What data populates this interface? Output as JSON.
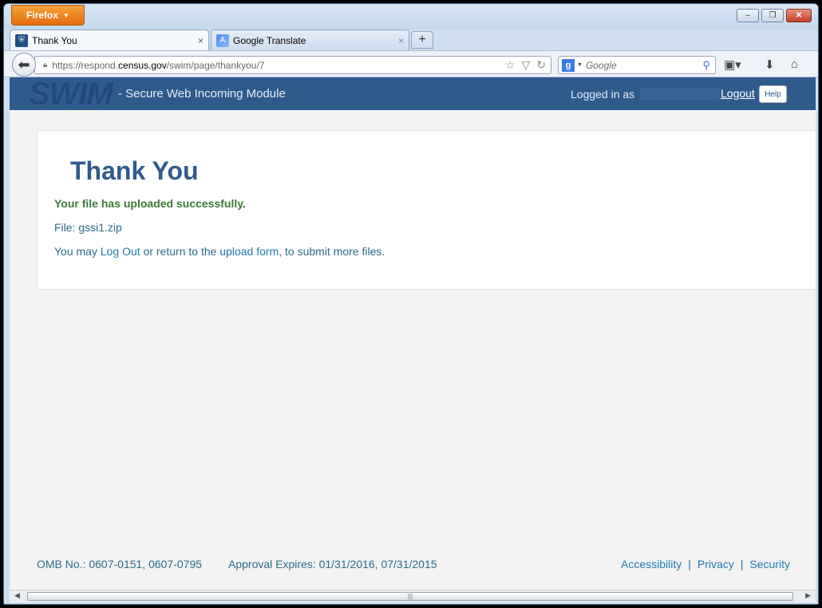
{
  "browser": {
    "app_button_label": "Firefox",
    "tabs": [
      {
        "label": "Thank You",
        "close": "×"
      },
      {
        "label": "Google Translate",
        "close": "×"
      }
    ],
    "new_tab": "+",
    "url_scheme_host_prefix": "https://respond.",
    "url_domain": "census.gov",
    "url_path": "/swim/page/thankyou/7",
    "search_placeholder": "Google",
    "window_controls": {
      "minimize": "–",
      "maximize": "❐",
      "close": "✕"
    }
  },
  "header": {
    "logo": "SWIM",
    "subtitle": "- Secure Web Incoming Module",
    "logged_in_label": "Logged in as",
    "logout_label": "Logout",
    "help_label": "Help"
  },
  "main": {
    "title": "Thank You",
    "success_message": "Your file has uploaded successfully.",
    "file_prefix": "File: ",
    "file_name": "gssi1.zip",
    "info_text_1": "You may ",
    "logout_link": "Log Out",
    "info_text_2": " or return to the ",
    "upload_link": "upload form",
    "info_text_3": ", to submit more files."
  },
  "footer": {
    "omb": "OMB No.: 0607-0151, 0607-0795",
    "approval": "Approval Expires: 01/31/2016, 07/31/2015",
    "links": [
      "Accessibility",
      "Privacy",
      "Security"
    ],
    "separator": "|"
  },
  "icons": {
    "back": "back-arrow-icon",
    "lock": "lock-icon",
    "bookmark_star": "star-icon",
    "reload": "reload-icon",
    "search": "magnifier-icon",
    "bookmarks": "bookmarks-icon",
    "downloads": "download-icon",
    "home": "home-icon"
  }
}
